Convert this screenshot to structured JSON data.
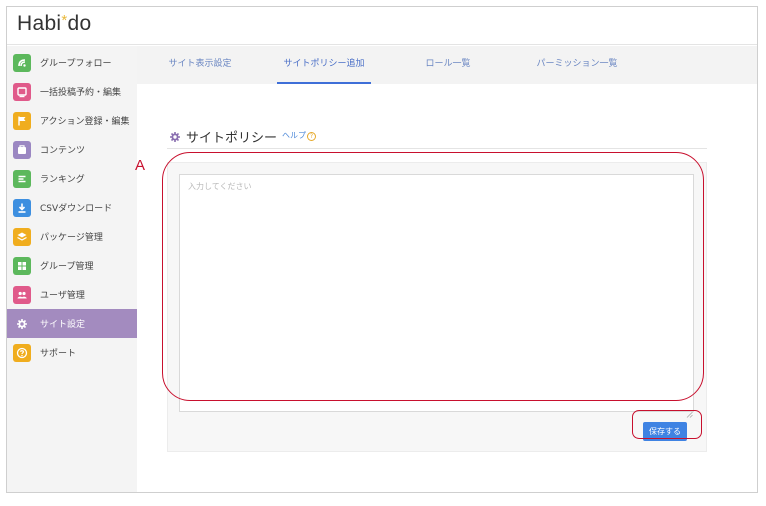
{
  "app": {
    "logo_prefix": "Habi",
    "logo_star": "*",
    "logo_suffix": "do"
  },
  "sidebar": {
    "items": [
      {
        "label": "グループフォロー",
        "icon": "group-follow-icon",
        "color": "#5cb85c"
      },
      {
        "label": "一括投稿予約・編集",
        "icon": "bulk-post-icon",
        "color": "#e05a8a"
      },
      {
        "label": "アクション登録・編集",
        "icon": "flag-icon",
        "color": "#f0ad1e"
      },
      {
        "label": "コンテンツ",
        "icon": "contents-icon",
        "color": "#9b87c2"
      },
      {
        "label": "ランキング",
        "icon": "ranking-icon",
        "color": "#5cb85c"
      },
      {
        "label": "CSVダウンロード",
        "icon": "download-icon",
        "color": "#3d8fe0"
      },
      {
        "label": "パッケージ管理",
        "icon": "package-icon",
        "color": "#f0ad1e"
      },
      {
        "label": "グループ管理",
        "icon": "group-manage-icon",
        "color": "#5cb85c"
      },
      {
        "label": "ユーザ管理",
        "icon": "users-icon",
        "color": "#e05a8a"
      },
      {
        "label": "サイト設定",
        "icon": "gear-icon",
        "color": "#a38bbf",
        "active": true
      },
      {
        "label": "サポート",
        "icon": "help-circle-icon",
        "color": "#f0ad1e"
      }
    ]
  },
  "tabs": [
    {
      "label": "サイト表示設定"
    },
    {
      "label": "サイトポリシー追加",
      "active": true
    },
    {
      "label": "ロール一覧"
    },
    {
      "label": "パーミッション一覧"
    }
  ],
  "section": {
    "title": "サイトポリシー",
    "help_label": "ヘルプ",
    "help_icon": "?"
  },
  "editor": {
    "placeholder": "入力してください",
    "value": ""
  },
  "actions": {
    "save_label": "保存する"
  },
  "annotation": {
    "label": "A",
    "color": "#c8102e"
  }
}
